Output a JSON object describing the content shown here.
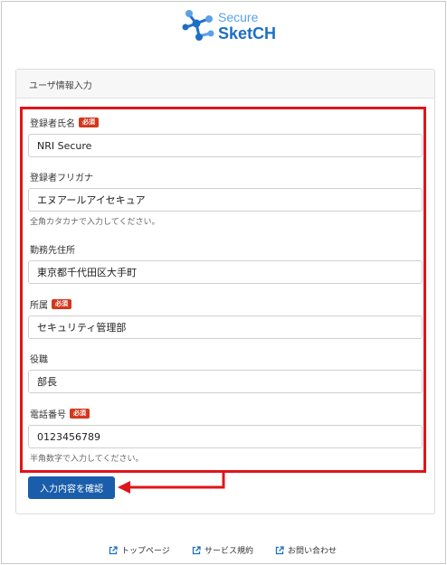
{
  "brand": {
    "line1": "Secure",
    "line2": "SketCH"
  },
  "card": {
    "title": "ユーザ情報入力"
  },
  "required_badge": "必須",
  "fields": {
    "name": {
      "label": "登録者氏名",
      "value": "NRI Secure"
    },
    "furigana": {
      "label": "登録者フリガナ",
      "value": "エヌアールアイセキュア",
      "hint": "全角カタカナで入力してください。"
    },
    "company_address": {
      "label": "勤務先住所",
      "value": "東京都千代田区大手町"
    },
    "department": {
      "label": "所属",
      "value": "セキュリティ管理部"
    },
    "position": {
      "label": "役職",
      "value": "部長"
    },
    "phone": {
      "label": "電話番号",
      "value": "0123456789",
      "hint": "半角数字で入力してください。"
    }
  },
  "confirm_button": "入力内容を確認",
  "footer": {
    "top_page": "トップページ",
    "terms": "サービス規約",
    "contact": "お問い合わせ"
  },
  "colors": {
    "brand_light": "#5aa1e6",
    "brand_dark": "#1d6fc4",
    "button": "#1a5eab",
    "required": "#d4371c",
    "highlight": "#e0141b"
  }
}
